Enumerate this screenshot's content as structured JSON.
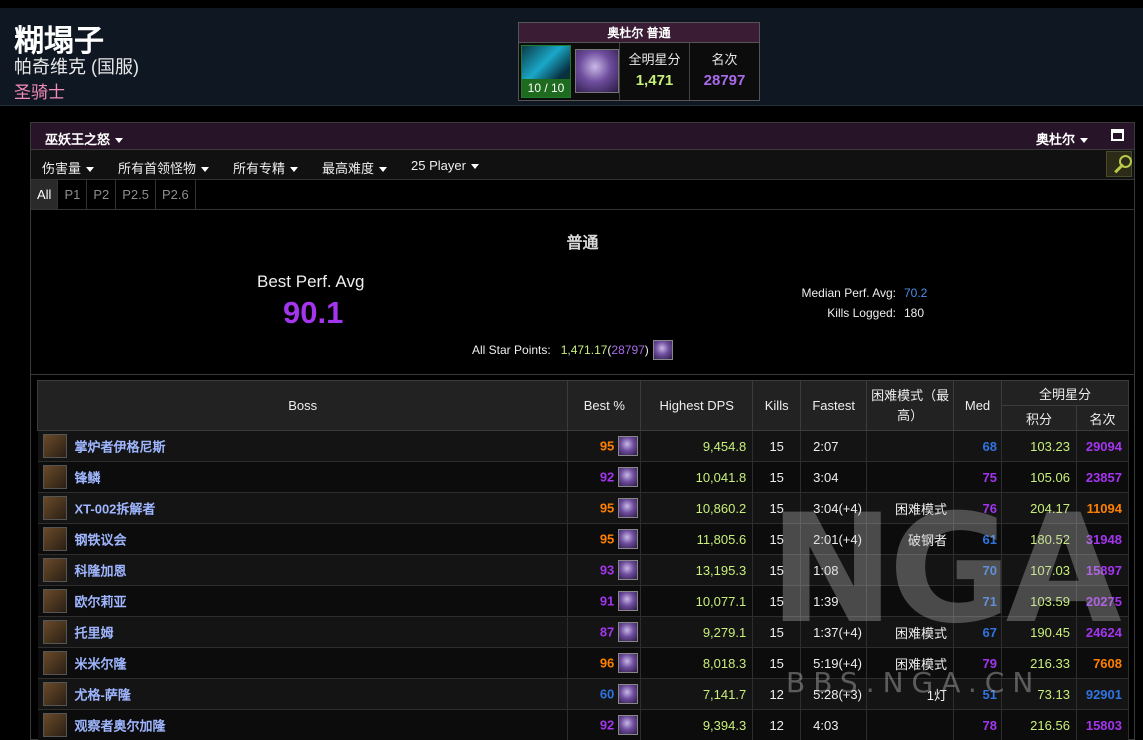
{
  "character": {
    "name": "糊塌子",
    "server": "帕奇维克 (国服)",
    "class": "圣骑士"
  },
  "zone_card": {
    "title": "奥杜尔 普通",
    "progress": "10 / 10",
    "stars_label": "全明星分",
    "stars_value": "1,471",
    "rank_label": "名次",
    "rank_value": "28797"
  },
  "zone_bar": {
    "zone": "巫妖王之怒",
    "difficulty": "奥杜尔"
  },
  "filters": {
    "metric": "伤害量",
    "bosses": "所有首领怪物",
    "specs": "所有专精",
    "difficulty": "最高难度",
    "size": "25 Player"
  },
  "partitions": [
    "All",
    "P1",
    "P2",
    "P2.5",
    "P2.6"
  ],
  "summary": {
    "difficulty": "普通",
    "best_label": "Best Perf. Avg",
    "best_value": "90.1",
    "median_label": "Median Perf. Avg:",
    "median_value": "70.2",
    "kills_label": "Kills Logged:",
    "kills_value": "180",
    "stars_label": "All Star Points:",
    "stars_points": "1,471.17",
    "stars_rank_open": " (",
    "stars_rank": "28797",
    "stars_rank_close": ")"
  },
  "table": {
    "headers": {
      "boss": "Boss",
      "best": "Best %",
      "dps": "Highest DPS",
      "kills": "Kills",
      "fastest": "Fastest",
      "hard": "困难模式（最高）",
      "med": "Med",
      "stars": "全明星分",
      "score": "积分",
      "rank": "名次"
    },
    "rows": [
      {
        "boss": "掌炉者伊格尼斯",
        "best": "95",
        "best_color": "#ff8000",
        "dps": "9,454.8",
        "kills": "15",
        "fastest": "2:07",
        "hard": "",
        "med": "68",
        "med_color": "#2f74e0",
        "score": "103.23",
        "rank": "29094",
        "rank_color": "#a335ee"
      },
      {
        "boss": "锋鳞",
        "best": "92",
        "best_color": "#a335ee",
        "dps": "10,041.8",
        "kills": "15",
        "fastest": "3:04",
        "hard": "",
        "med": "75",
        "med_color": "#a335ee",
        "score": "105.06",
        "rank": "23857",
        "rank_color": "#a335ee"
      },
      {
        "boss": "XT-002拆解者",
        "best": "95",
        "best_color": "#ff8000",
        "dps": "10,860.2",
        "kills": "15",
        "fastest": "3:04(+4)",
        "hard": "困难模式",
        "med": "76",
        "med_color": "#a335ee",
        "score": "204.17",
        "rank": "11094",
        "rank_color": "#ff8000"
      },
      {
        "boss": "钢铁议会",
        "best": "95",
        "best_color": "#ff8000",
        "dps": "11,805.6",
        "kills": "15",
        "fastest": "2:01(+4)",
        "hard": "破钢者",
        "med": "61",
        "med_color": "#2f74e0",
        "score": "180.52",
        "rank": "31948",
        "rank_color": "#a335ee"
      },
      {
        "boss": "科隆加恩",
        "best": "93",
        "best_color": "#a335ee",
        "dps": "13,195.3",
        "kills": "15",
        "fastest": "1:08",
        "hard": "",
        "med": "70",
        "med_color": "#2f74e0",
        "score": "107.03",
        "rank": "15897",
        "rank_color": "#a335ee"
      },
      {
        "boss": "欧尔莉亚",
        "best": "91",
        "best_color": "#a335ee",
        "dps": "10,077.1",
        "kills": "15",
        "fastest": "1:39",
        "hard": "",
        "med": "71",
        "med_color": "#2f74e0",
        "score": "103.59",
        "rank": "20275",
        "rank_color": "#a335ee"
      },
      {
        "boss": "托里姆",
        "best": "87",
        "best_color": "#a335ee",
        "dps": "9,279.1",
        "kills": "15",
        "fastest": "1:37(+4)",
        "hard": "困难模式",
        "med": "67",
        "med_color": "#2f74e0",
        "score": "190.45",
        "rank": "24624",
        "rank_color": "#a335ee"
      },
      {
        "boss": "米米尔隆",
        "best": "96",
        "best_color": "#ff8000",
        "dps": "8,018.3",
        "kills": "15",
        "fastest": "5:19(+4)",
        "hard": "困难模式",
        "med": "79",
        "med_color": "#a335ee",
        "score": "216.33",
        "rank": "7608",
        "rank_color": "#ff8000"
      },
      {
        "boss": "尤格-萨隆",
        "best": "60",
        "best_color": "#2f74e0",
        "dps": "7,141.7",
        "kills": "12",
        "fastest": "5:28(+3)",
        "hard": "1灯",
        "med": "51",
        "med_color": "#2f74e0",
        "score": "73.13",
        "rank": "92901",
        "rank_color": "#2f74e0"
      },
      {
        "boss": "观察者奥尔加隆",
        "best": "92",
        "best_color": "#a335ee",
        "dps": "9,394.3",
        "kills": "12",
        "fastest": "4:03",
        "hard": "",
        "med": "78",
        "med_color": "#a335ee",
        "score": "216.56",
        "rank": "15803",
        "rank_color": "#a335ee"
      }
    ]
  },
  "watermark": {
    "logo": "NGA",
    "url": "BBS.NGA.CN"
  }
}
